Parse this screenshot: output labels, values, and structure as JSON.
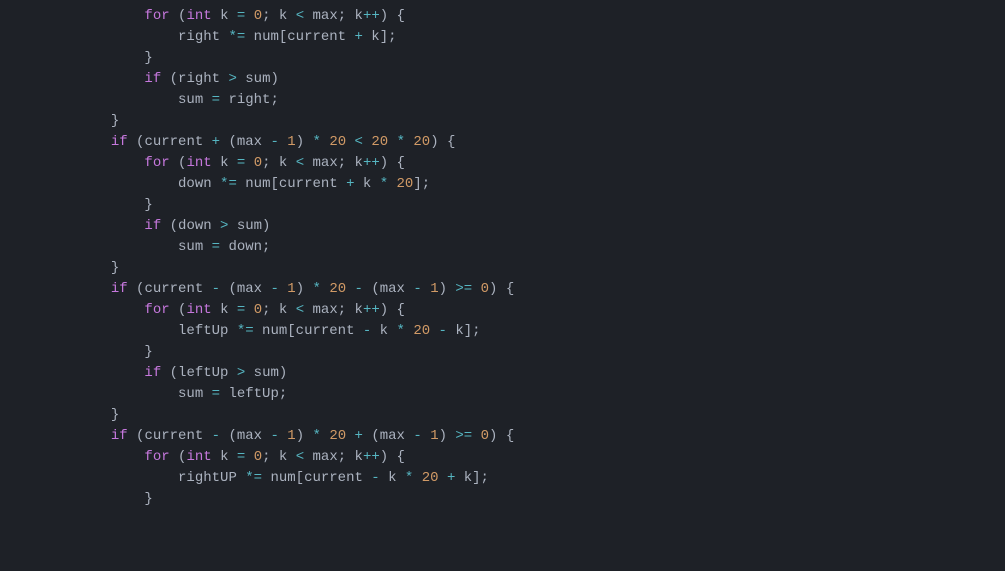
{
  "code": {
    "lines": [
      {
        "indent": 16,
        "tokens": [
          {
            "t": "for",
            "c": "kw"
          },
          {
            "t": " (",
            "c": "punc"
          },
          {
            "t": "int",
            "c": "kw"
          },
          {
            "t": " k ",
            "c": "id"
          },
          {
            "t": "=",
            "c": "op"
          },
          {
            "t": " ",
            "c": "id"
          },
          {
            "t": "0",
            "c": "num"
          },
          {
            "t": "; k ",
            "c": "id"
          },
          {
            "t": "<",
            "c": "op"
          },
          {
            "t": " max; k",
            "c": "id"
          },
          {
            "t": "++",
            "c": "op"
          },
          {
            "t": ") {",
            "c": "punc"
          }
        ]
      },
      {
        "indent": 20,
        "tokens": [
          {
            "t": "right ",
            "c": "id"
          },
          {
            "t": "*=",
            "c": "op"
          },
          {
            "t": " num[current ",
            "c": "id"
          },
          {
            "t": "+",
            "c": "op"
          },
          {
            "t": " k];",
            "c": "id"
          }
        ]
      },
      {
        "indent": 16,
        "tokens": [
          {
            "t": "}",
            "c": "punc"
          }
        ]
      },
      {
        "indent": 16,
        "tokens": [
          {
            "t": "if",
            "c": "kw"
          },
          {
            "t": " (right ",
            "c": "id"
          },
          {
            "t": ">",
            "c": "op"
          },
          {
            "t": " sum)",
            "c": "id"
          }
        ]
      },
      {
        "indent": 20,
        "tokens": [
          {
            "t": "sum ",
            "c": "id"
          },
          {
            "t": "=",
            "c": "op"
          },
          {
            "t": " right;",
            "c": "id"
          }
        ]
      },
      {
        "indent": 12,
        "tokens": [
          {
            "t": "}",
            "c": "punc"
          }
        ]
      },
      {
        "indent": 0,
        "tokens": [
          {
            "t": "",
            "c": "id"
          }
        ]
      },
      {
        "indent": 12,
        "tokens": [
          {
            "t": "if",
            "c": "kw"
          },
          {
            "t": " (current ",
            "c": "id"
          },
          {
            "t": "+",
            "c": "op"
          },
          {
            "t": " (max ",
            "c": "id"
          },
          {
            "t": "-",
            "c": "op"
          },
          {
            "t": " ",
            "c": "id"
          },
          {
            "t": "1",
            "c": "num"
          },
          {
            "t": ") ",
            "c": "id"
          },
          {
            "t": "*",
            "c": "op"
          },
          {
            "t": " ",
            "c": "id"
          },
          {
            "t": "20",
            "c": "num"
          },
          {
            "t": " ",
            "c": "id"
          },
          {
            "t": "<",
            "c": "op"
          },
          {
            "t": " ",
            "c": "id"
          },
          {
            "t": "20",
            "c": "num"
          },
          {
            "t": " ",
            "c": "id"
          },
          {
            "t": "*",
            "c": "op"
          },
          {
            "t": " ",
            "c": "id"
          },
          {
            "t": "20",
            "c": "num"
          },
          {
            "t": ") {",
            "c": "punc"
          }
        ]
      },
      {
        "indent": 16,
        "tokens": [
          {
            "t": "for",
            "c": "kw"
          },
          {
            "t": " (",
            "c": "punc"
          },
          {
            "t": "int",
            "c": "kw"
          },
          {
            "t": " k ",
            "c": "id"
          },
          {
            "t": "=",
            "c": "op"
          },
          {
            "t": " ",
            "c": "id"
          },
          {
            "t": "0",
            "c": "num"
          },
          {
            "t": "; k ",
            "c": "id"
          },
          {
            "t": "<",
            "c": "op"
          },
          {
            "t": " max; k",
            "c": "id"
          },
          {
            "t": "++",
            "c": "op"
          },
          {
            "t": ") {",
            "c": "punc"
          }
        ]
      },
      {
        "indent": 20,
        "tokens": [
          {
            "t": "down ",
            "c": "id"
          },
          {
            "t": "*=",
            "c": "op"
          },
          {
            "t": " num[current ",
            "c": "id"
          },
          {
            "t": "+",
            "c": "op"
          },
          {
            "t": " k ",
            "c": "id"
          },
          {
            "t": "*",
            "c": "op"
          },
          {
            "t": " ",
            "c": "id"
          },
          {
            "t": "20",
            "c": "num"
          },
          {
            "t": "];",
            "c": "id"
          }
        ]
      },
      {
        "indent": 16,
        "tokens": [
          {
            "t": "}",
            "c": "punc"
          }
        ]
      },
      {
        "indent": 16,
        "tokens": [
          {
            "t": "if",
            "c": "kw"
          },
          {
            "t": " (down ",
            "c": "id"
          },
          {
            "t": ">",
            "c": "op"
          },
          {
            "t": " sum)",
            "c": "id"
          }
        ]
      },
      {
        "indent": 20,
        "tokens": [
          {
            "t": "sum ",
            "c": "id"
          },
          {
            "t": "=",
            "c": "op"
          },
          {
            "t": " down;",
            "c": "id"
          }
        ]
      },
      {
        "indent": 12,
        "tokens": [
          {
            "t": "}",
            "c": "punc"
          }
        ]
      },
      {
        "indent": 0,
        "tokens": [
          {
            "t": "",
            "c": "id"
          }
        ]
      },
      {
        "indent": 12,
        "tokens": [
          {
            "t": "if",
            "c": "kw"
          },
          {
            "t": " (current ",
            "c": "id"
          },
          {
            "t": "-",
            "c": "op"
          },
          {
            "t": " (max ",
            "c": "id"
          },
          {
            "t": "-",
            "c": "op"
          },
          {
            "t": " ",
            "c": "id"
          },
          {
            "t": "1",
            "c": "num"
          },
          {
            "t": ") ",
            "c": "id"
          },
          {
            "t": "*",
            "c": "op"
          },
          {
            "t": " ",
            "c": "id"
          },
          {
            "t": "20",
            "c": "num"
          },
          {
            "t": " ",
            "c": "id"
          },
          {
            "t": "-",
            "c": "op"
          },
          {
            "t": " (max ",
            "c": "id"
          },
          {
            "t": "-",
            "c": "op"
          },
          {
            "t": " ",
            "c": "id"
          },
          {
            "t": "1",
            "c": "num"
          },
          {
            "t": ") ",
            "c": "id"
          },
          {
            "t": ">=",
            "c": "op"
          },
          {
            "t": " ",
            "c": "id"
          },
          {
            "t": "0",
            "c": "num"
          },
          {
            "t": ") {",
            "c": "punc"
          }
        ]
      },
      {
        "indent": 16,
        "tokens": [
          {
            "t": "for",
            "c": "kw"
          },
          {
            "t": " (",
            "c": "punc"
          },
          {
            "t": "int",
            "c": "kw"
          },
          {
            "t": " k ",
            "c": "id"
          },
          {
            "t": "=",
            "c": "op"
          },
          {
            "t": " ",
            "c": "id"
          },
          {
            "t": "0",
            "c": "num"
          },
          {
            "t": "; k ",
            "c": "id"
          },
          {
            "t": "<",
            "c": "op"
          },
          {
            "t": " max; k",
            "c": "id"
          },
          {
            "t": "++",
            "c": "op"
          },
          {
            "t": ") {",
            "c": "punc"
          }
        ]
      },
      {
        "indent": 20,
        "tokens": [
          {
            "t": "leftUp ",
            "c": "id"
          },
          {
            "t": "*=",
            "c": "op"
          },
          {
            "t": " num[current ",
            "c": "id"
          },
          {
            "t": "-",
            "c": "op"
          },
          {
            "t": " k ",
            "c": "id"
          },
          {
            "t": "*",
            "c": "op"
          },
          {
            "t": " ",
            "c": "id"
          },
          {
            "t": "20",
            "c": "num"
          },
          {
            "t": " ",
            "c": "id"
          },
          {
            "t": "-",
            "c": "op"
          },
          {
            "t": " k];",
            "c": "id"
          }
        ]
      },
      {
        "indent": 16,
        "tokens": [
          {
            "t": "}",
            "c": "punc"
          }
        ]
      },
      {
        "indent": 16,
        "tokens": [
          {
            "t": "if",
            "c": "kw"
          },
          {
            "t": " (leftUp ",
            "c": "id"
          },
          {
            "t": ">",
            "c": "op"
          },
          {
            "t": " sum)",
            "c": "id"
          }
        ]
      },
      {
        "indent": 20,
        "tokens": [
          {
            "t": "sum ",
            "c": "id"
          },
          {
            "t": "=",
            "c": "op"
          },
          {
            "t": " leftUp;",
            "c": "id"
          }
        ]
      },
      {
        "indent": 12,
        "tokens": [
          {
            "t": "}",
            "c": "punc"
          }
        ]
      },
      {
        "indent": 0,
        "tokens": [
          {
            "t": "",
            "c": "id"
          }
        ]
      },
      {
        "indent": 12,
        "tokens": [
          {
            "t": "if",
            "c": "kw"
          },
          {
            "t": " (current ",
            "c": "id"
          },
          {
            "t": "-",
            "c": "op"
          },
          {
            "t": " (max ",
            "c": "id"
          },
          {
            "t": "-",
            "c": "op"
          },
          {
            "t": " ",
            "c": "id"
          },
          {
            "t": "1",
            "c": "num"
          },
          {
            "t": ") ",
            "c": "id"
          },
          {
            "t": "*",
            "c": "op"
          },
          {
            "t": " ",
            "c": "id"
          },
          {
            "t": "20",
            "c": "num"
          },
          {
            "t": " ",
            "c": "id"
          },
          {
            "t": "+",
            "c": "op"
          },
          {
            "t": " (max ",
            "c": "id"
          },
          {
            "t": "-",
            "c": "op"
          },
          {
            "t": " ",
            "c": "id"
          },
          {
            "t": "1",
            "c": "num"
          },
          {
            "t": ") ",
            "c": "id"
          },
          {
            "t": ">=",
            "c": "op"
          },
          {
            "t": " ",
            "c": "id"
          },
          {
            "t": "0",
            "c": "num"
          },
          {
            "t": ") {",
            "c": "punc"
          }
        ]
      },
      {
        "indent": 16,
        "tokens": [
          {
            "t": "for",
            "c": "kw"
          },
          {
            "t": " (",
            "c": "punc"
          },
          {
            "t": "int",
            "c": "kw"
          },
          {
            "t": " k ",
            "c": "id"
          },
          {
            "t": "=",
            "c": "op"
          },
          {
            "t": " ",
            "c": "id"
          },
          {
            "t": "0",
            "c": "num"
          },
          {
            "t": "; k ",
            "c": "id"
          },
          {
            "t": "<",
            "c": "op"
          },
          {
            "t": " max; k",
            "c": "id"
          },
          {
            "t": "++",
            "c": "op"
          },
          {
            "t": ") {",
            "c": "punc"
          }
        ]
      },
      {
        "indent": 20,
        "tokens": [
          {
            "t": "rightUP ",
            "c": "id"
          },
          {
            "t": "*=",
            "c": "op"
          },
          {
            "t": " num[current ",
            "c": "id"
          },
          {
            "t": "-",
            "c": "op"
          },
          {
            "t": " k ",
            "c": "id"
          },
          {
            "t": "*",
            "c": "op"
          },
          {
            "t": " ",
            "c": "id"
          },
          {
            "t": "20",
            "c": "num"
          },
          {
            "t": " ",
            "c": "id"
          },
          {
            "t": "+",
            "c": "op"
          },
          {
            "t": " k];",
            "c": "id"
          }
        ]
      },
      {
        "indent": 16,
        "tokens": [
          {
            "t": "}",
            "c": "punc"
          }
        ]
      }
    ]
  }
}
